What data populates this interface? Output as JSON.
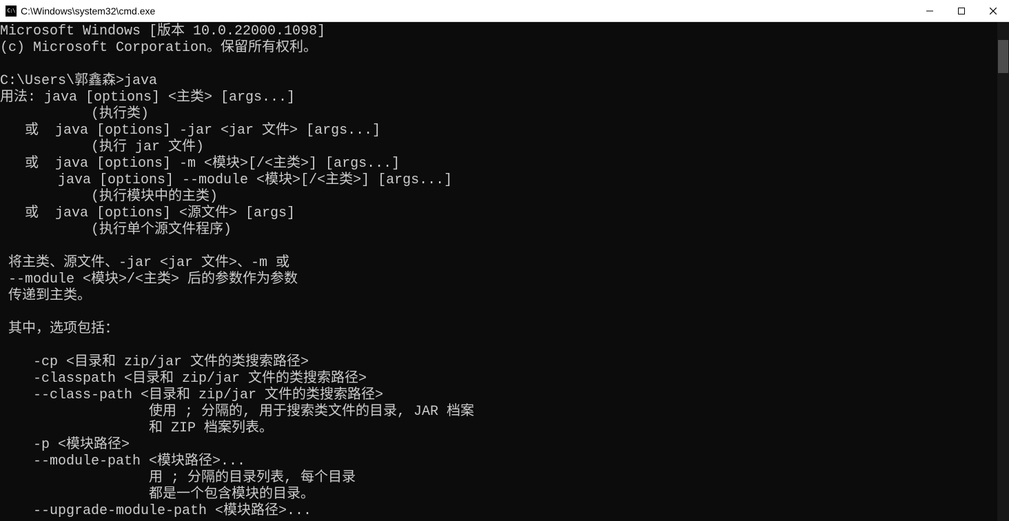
{
  "window": {
    "title": "C:\\Windows\\system32\\cmd.exe",
    "icon_label": "C:\\"
  },
  "terminal": {
    "lines": [
      "Microsoft Windows [版本 10.0.22000.1098]",
      "(c) Microsoft Corporation。保留所有权利。",
      "",
      "C:\\Users\\郭鑫森>java",
      "用法: java [options] <主类> [args...]",
      "           (执行类)",
      "   或  java [options] -jar <jar 文件> [args...]",
      "           (执行 jar 文件)",
      "   或  java [options] -m <模块>[/<主类>] [args...]",
      "       java [options] --module <模块>[/<主类>] [args...]",
      "           (执行模块中的主类)",
      "   或  java [options] <源文件> [args]",
      "           (执行单个源文件程序)",
      "",
      " 将主类、源文件、-jar <jar 文件>、-m 或",
      " --module <模块>/<主类> 后的参数作为参数",
      " 传递到主类。",
      "",
      " 其中，选项包括：",
      "",
      "    -cp <目录和 zip/jar 文件的类搜索路径>",
      "    -classpath <目录和 zip/jar 文件的类搜索路径>",
      "    --class-path <目录和 zip/jar 文件的类搜索路径>",
      "                  使用 ; 分隔的, 用于搜索类文件的目录, JAR 档案",
      "                  和 ZIP 档案列表。",
      "    -p <模块路径>",
      "    --module-path <模块路径>...",
      "                  用 ; 分隔的目录列表, 每个目录",
      "                  都是一个包含模块的目录。",
      "    --upgrade-module-path <模块路径>..."
    ]
  }
}
